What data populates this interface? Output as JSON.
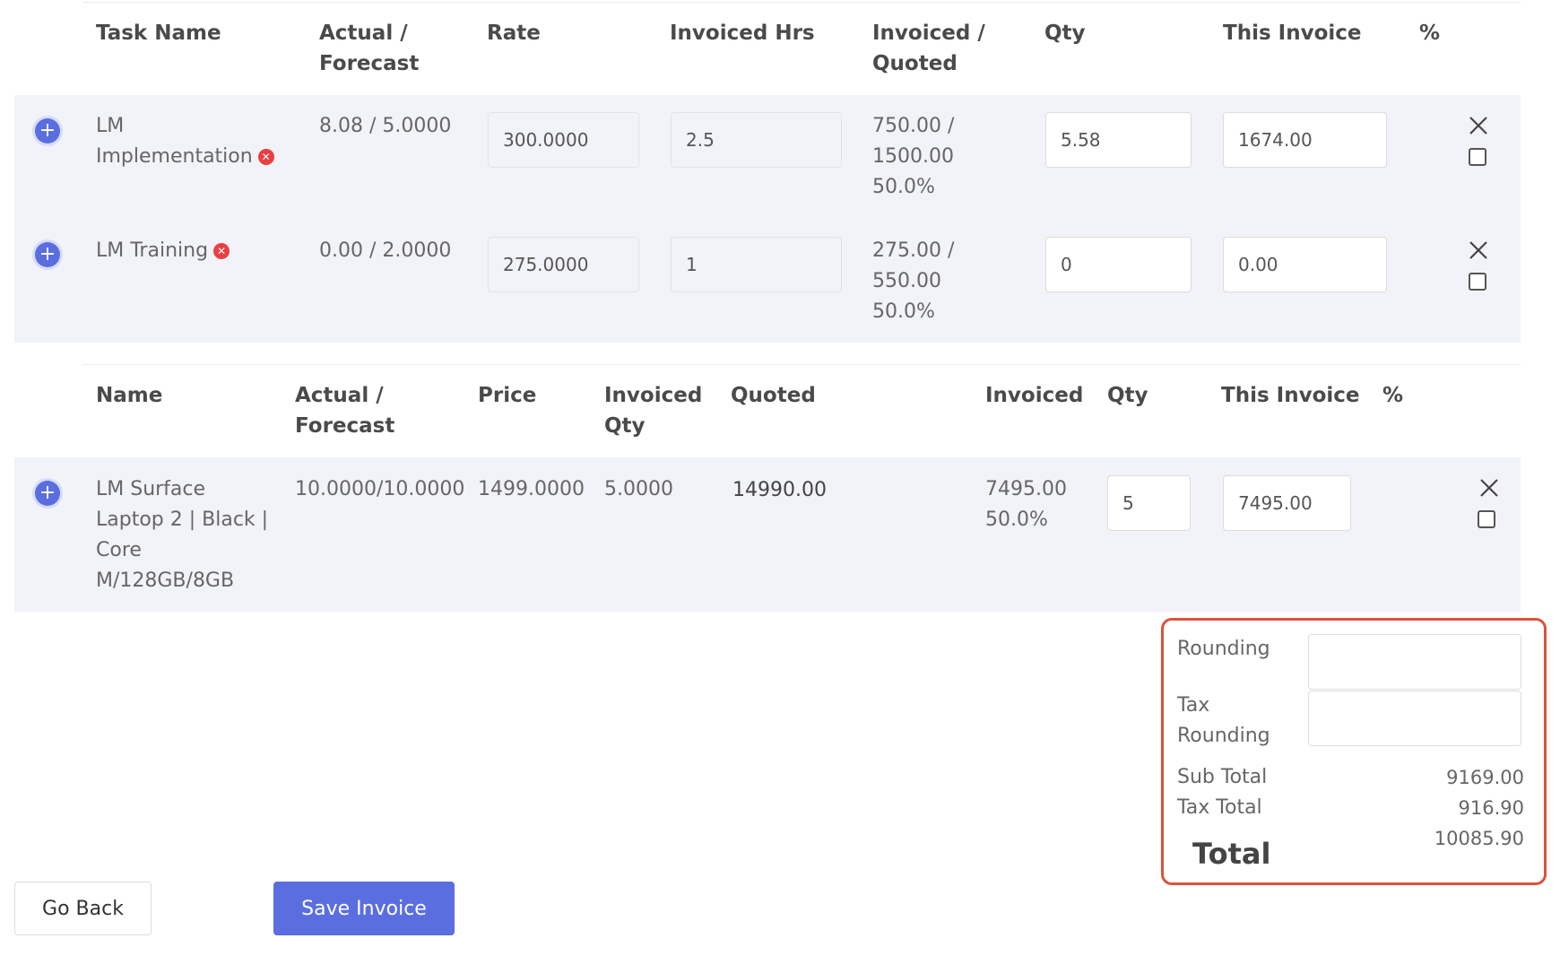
{
  "tasks_table": {
    "headers": [
      "Task Name",
      "Actual /\nForecast",
      "Rate",
      "Invoiced Hrs",
      "Invoiced /\nQuoted",
      "Qty",
      "This Invoice",
      "%"
    ],
    "rows": [
      {
        "name": "LM\nImplementation",
        "actual_forecast": "8.08 / 5.0000",
        "rate": "300.0000",
        "invoiced_hrs": "2.5",
        "invoiced_quoted": "750.00 /\n1500.00\n50.0%",
        "qty": "5.58",
        "this_invoice": "1674.00"
      },
      {
        "name": "LM Training",
        "actual_forecast": "0.00 / 2.0000",
        "rate": "275.0000",
        "invoiced_hrs": "1",
        "invoiced_quoted": "275.00 /\n550.00\n50.0%",
        "qty": "0",
        "this_invoice": "0.00"
      }
    ]
  },
  "products_table": {
    "headers": [
      "Name",
      "Actual /\nForecast",
      "Price",
      "Invoiced\nQty",
      "Quoted",
      "Invoiced",
      "Qty",
      "This Invoice",
      "%"
    ],
    "rows": [
      {
        "name": "LM Surface\nLaptop 2 | Black |\nCore\nM/128GB/8GB",
        "actual_forecast": "10.0000/10.0000",
        "price": "1499.0000",
        "invoiced_qty": "5.0000",
        "quoted": "14990.00",
        "invoiced": "7495.00\n50.0%",
        "qty": "5",
        "this_invoice": "7495.00"
      }
    ]
  },
  "totals": {
    "rounding_label": "Rounding",
    "rounding_value": "",
    "tax_rounding_label": "Tax\nRounding",
    "tax_rounding_value": "",
    "sub_total_label": "Sub Total",
    "sub_total_value": "9169.00",
    "tax_total_label": "Tax Total",
    "tax_total_value": "916.90",
    "total_label": "Total",
    "total_value": "10085.90"
  },
  "buttons": {
    "go_back": "Go Back",
    "save_invoice": "Save Invoice"
  },
  "colors": {
    "accent": "#5a6ee0",
    "highlight_border": "#d9533e",
    "row_bg": "#f2f3f8",
    "error": "#e94040"
  }
}
